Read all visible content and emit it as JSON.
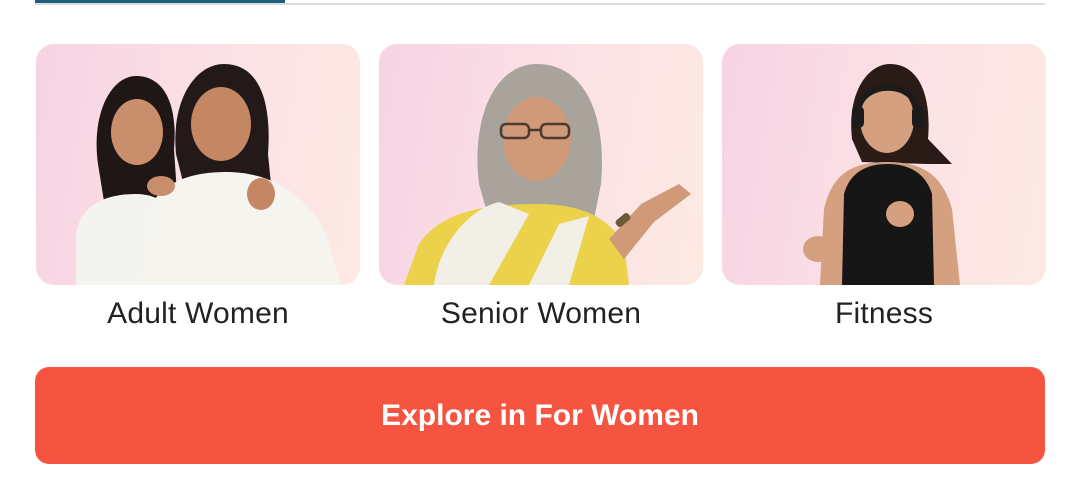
{
  "categories": [
    {
      "label": "Adult Women",
      "image_icon": "adult-women-photo-icon"
    },
    {
      "label": "Senior Women",
      "image_icon": "senior-women-photo-icon"
    },
    {
      "label": "Fitness",
      "image_icon": "fitness-photo-icon"
    }
  ],
  "cta": {
    "label": "Explore in For Women"
  },
  "colors": {
    "cta_background": "#f45440",
    "card_background": "#f9dce4",
    "tab_indicator": "#1e5f7a"
  }
}
